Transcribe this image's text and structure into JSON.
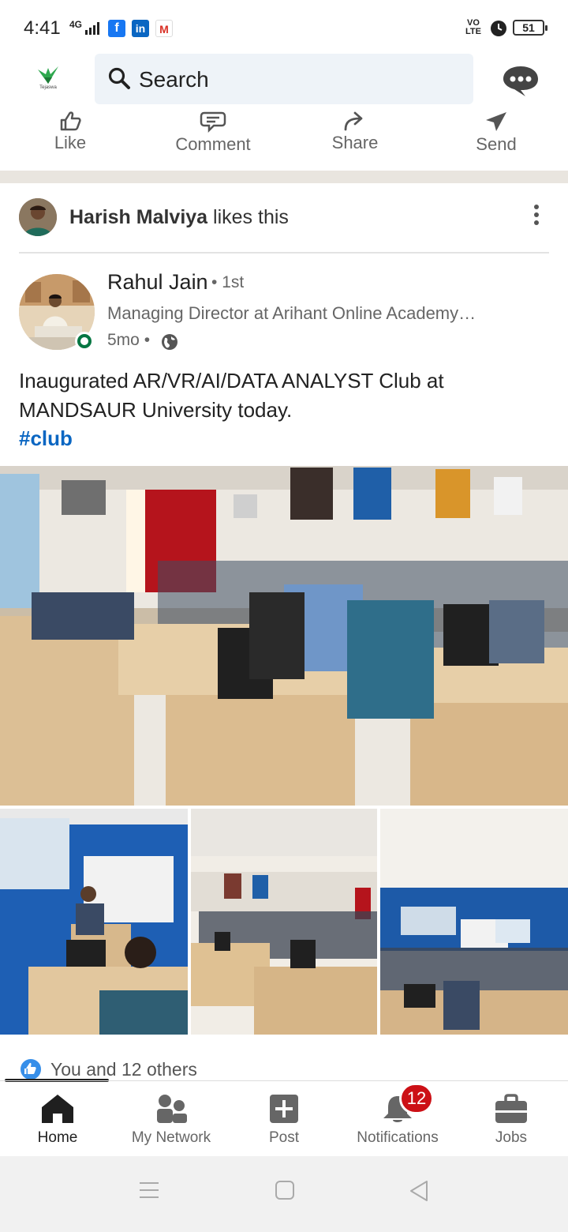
{
  "status_bar": {
    "time": "4:41",
    "network": "4G",
    "volte_top": "VO",
    "volte_bottom": "LTE",
    "battery": "51",
    "app_icons": [
      "facebook-icon",
      "linkedin-icon",
      "gmail-icon"
    ]
  },
  "top_bar": {
    "logo_text": "Tejaswa",
    "search_placeholder": "Search",
    "messaging_icon": "messaging-icon"
  },
  "prev_actions": [
    {
      "label": "Like",
      "icon": "like-icon"
    },
    {
      "label": "Comment",
      "icon": "comment-icon"
    },
    {
      "label": "Share",
      "icon": "share-icon"
    },
    {
      "label": "Send",
      "icon": "send-icon"
    }
  ],
  "post": {
    "liker_name": "Harish Malviya",
    "liker_suffix": "likes this",
    "author_name": "Rahul Jain",
    "degree": "1st",
    "headline": "Managing Director at Arihant Online Academy…",
    "time": "5mo",
    "text": "Inaugurated AR/VR/AI/DATA ANALYST Club at MANDSAUR University today.",
    "hashtag": "#club",
    "reactions": "You and 12 others"
  },
  "bottom_nav": [
    {
      "label": "Home",
      "icon": "home-icon",
      "active": true
    },
    {
      "label": "My Network",
      "icon": "network-icon"
    },
    {
      "label": "Post",
      "icon": "post-icon"
    },
    {
      "label": "Notifications",
      "icon": "bell-icon",
      "badge": "12"
    },
    {
      "label": "Jobs",
      "icon": "briefcase-icon"
    }
  ],
  "colors": {
    "accent": "#0a66c2",
    "badge": "#cc1016",
    "online": "#057642",
    "search_bg": "#eef3f8"
  }
}
